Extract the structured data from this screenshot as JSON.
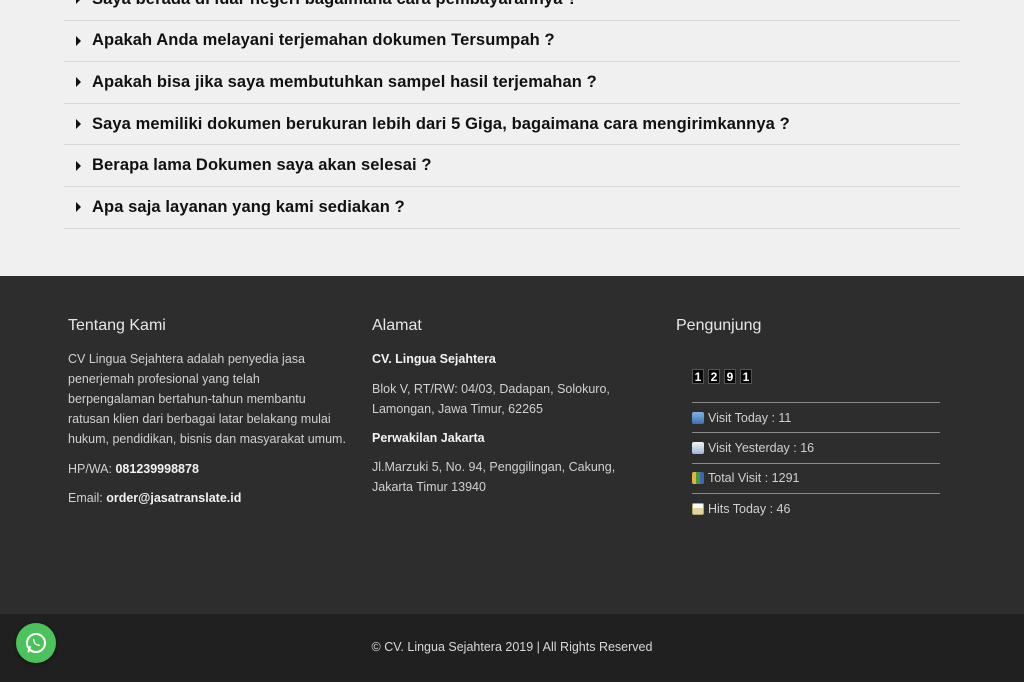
{
  "faq": {
    "items": [
      "Saya berada di luar negeri bagaimana cara pembayarannya ?",
      "Apakah Anda melayani terjemahan dokumen Tersumpah ?",
      "Apakah bisa jika saya membutuhkan sampel hasil terjemahan ?",
      "Saya memiliki dokumen berukuran lebih dari 5 Giga, bagaimana cara mengirimkannya ?",
      "Berapa lama Dokumen saya akan selesai ?",
      "Apa saja layanan yang kami sediakan ?"
    ]
  },
  "about": {
    "title": "Tentang Kami",
    "text": "CV Lingua Sejahtera adalah penyedia jasa penerjemah profesional yang telah berpengalaman bertahun-tahun membantu ratusan klien dari berbagai latar belakang mulai hukum, pendidikan, bisnis dan masyarakat umum.",
    "phone_label": "HP/WA: ",
    "phone": "081239998878",
    "email_label": "Email: ",
    "email": "order@jasatranslate.id"
  },
  "address": {
    "title": "Alamat",
    "company": "CV. Lingua Sejahtera",
    "address1": "Blok V, RT/RW: 04/03, Dadapan, Solokuro, Lamongan, Jawa Timur, 62265",
    "branch": "Perwakilan Jakarta",
    "address2": "Jl.Marzuki 5, No. 94, Penggilingan, Cakung, Jakarta Timur 13940"
  },
  "visitors": {
    "title": "Pengunjung",
    "digits": [
      "1",
      "2",
      "9",
      "1"
    ],
    "stats": [
      {
        "icon": "visit-today-icon",
        "text": "Visit Today : 11"
      },
      {
        "icon": "visit-yesterday-icon",
        "text": "Visit Yesterday : 16"
      },
      {
        "icon": "total-visit-chart-icon",
        "text": "Total Visit : 1291"
      },
      {
        "icon": "hits-today-calendar-icon",
        "text": "Hits Today : 46"
      }
    ]
  },
  "footer": {
    "copyright": "© CV. Lingua Sejahtera 2019 | All Rights Reserved"
  },
  "colors": {
    "footer_bg": "#2d2d2d",
    "bottom_bar_bg": "#202020",
    "whatsapp": "#4cc35a"
  }
}
